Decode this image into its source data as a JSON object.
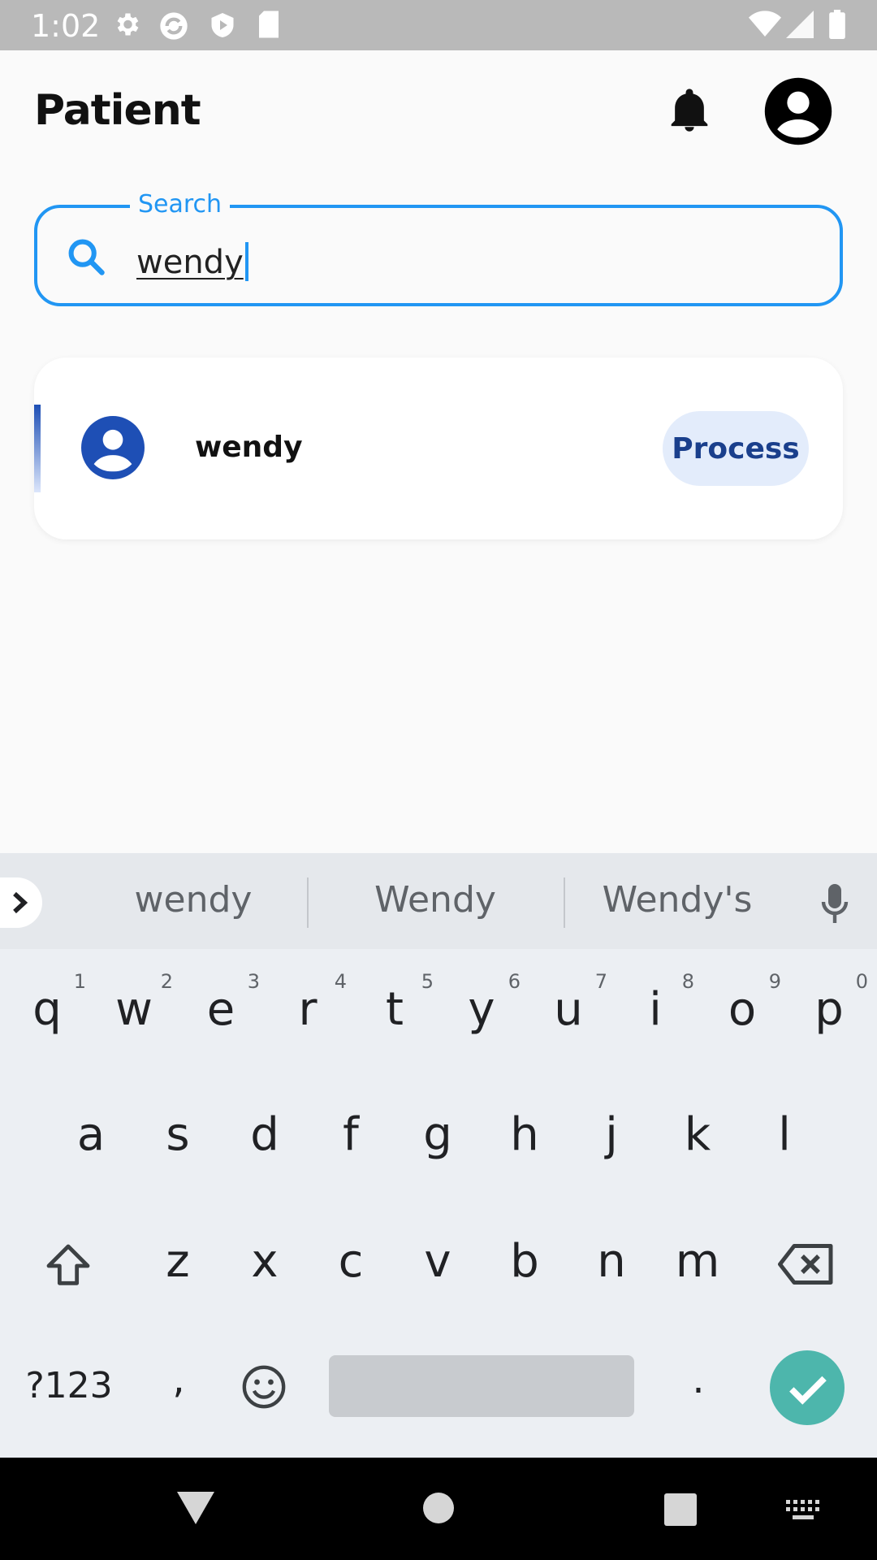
{
  "status_bar": {
    "time": "1:02",
    "icons": [
      "gear-icon",
      "sync-icon",
      "play-protect-icon",
      "sd-card-icon",
      "wifi-icon",
      "signal-icon",
      "battery-icon"
    ]
  },
  "app_bar": {
    "title": "Patient",
    "icons": [
      "bell-icon",
      "account-circle-icon"
    ]
  },
  "search": {
    "label": "Search",
    "value": "wendy",
    "accent_color": "#2196f3"
  },
  "results": [
    {
      "name": "wendy",
      "action_label": "Process"
    }
  ],
  "keyboard": {
    "suggestions": [
      "wendy",
      "Wendy",
      "Wendy's"
    ],
    "row1": [
      {
        "key": "q",
        "hint": "1"
      },
      {
        "key": "w",
        "hint": "2"
      },
      {
        "key": "e",
        "hint": "3"
      },
      {
        "key": "r",
        "hint": "4"
      },
      {
        "key": "t",
        "hint": "5"
      },
      {
        "key": "y",
        "hint": "6"
      },
      {
        "key": "u",
        "hint": "7"
      },
      {
        "key": "i",
        "hint": "8"
      },
      {
        "key": "o",
        "hint": "9"
      },
      {
        "key": "p",
        "hint": "0"
      }
    ],
    "row2": [
      "a",
      "s",
      "d",
      "f",
      "g",
      "h",
      "j",
      "k",
      "l"
    ],
    "row3": [
      "z",
      "x",
      "c",
      "v",
      "b",
      "n",
      "m"
    ],
    "symbols_label": "?123",
    "comma": ",",
    "period": ".",
    "enter_color": "#4db6ac"
  },
  "nav_bar": {
    "icons": [
      "back-icon",
      "home-icon",
      "recents-icon",
      "keyboard-switch-icon"
    ]
  }
}
